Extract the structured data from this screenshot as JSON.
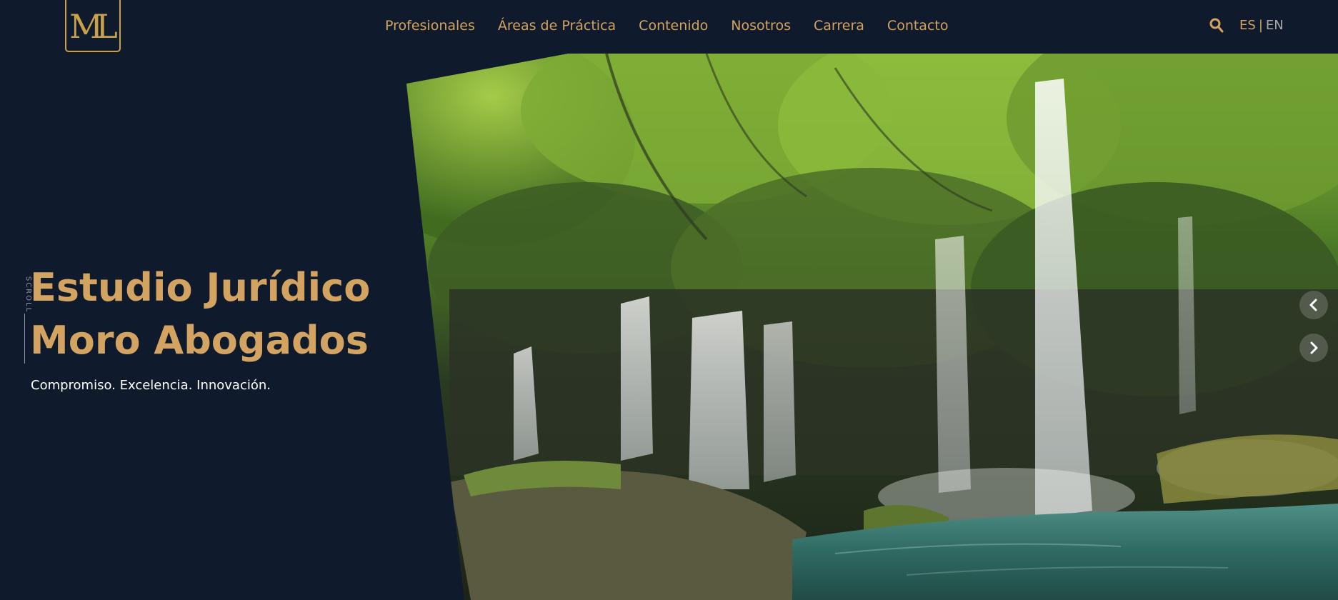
{
  "header": {
    "logo_text": "ML",
    "nav": [
      {
        "label": "Profesionales"
      },
      {
        "label": "Áreas de Práctica"
      },
      {
        "label": "Contenido"
      },
      {
        "label": "Nosotros"
      },
      {
        "label": "Carrera"
      },
      {
        "label": "Contacto"
      }
    ],
    "search_icon": "search-icon",
    "lang": {
      "es": "ES",
      "separator": "|",
      "en": "EN"
    }
  },
  "hero": {
    "scroll_label": "SCROLL",
    "title_line1": "Estudio Jurídico",
    "title_line2": "Moro Abogados",
    "subtitle": "Compromiso. Excelencia. Innovación.",
    "image_alt": "waterfall-photo",
    "prev_icon": "chevron-left-icon",
    "next_icon": "chevron-right-icon"
  },
  "colors": {
    "background": "#0f1a2c",
    "accent_gold": "#d3a461",
    "logo_gold": "#c9a14a",
    "text_white": "#ffffff",
    "lang_inactive": "#a9a9a9"
  }
}
